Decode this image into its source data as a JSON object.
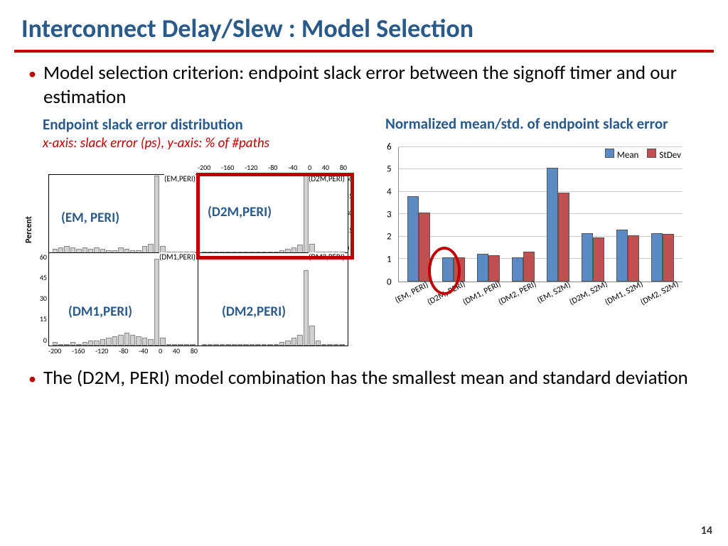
{
  "title": "Interconnect Delay/Slew : Model Selection",
  "bullets": {
    "b1": "Model selection criterion: endpoint slack error between the signoff timer and our estimation",
    "b2": "The (D2M, PERI) model combination has the smallest mean and standard deviation"
  },
  "left": {
    "subtitle": "Endpoint slack error distribution",
    "axis_note": "x-axis: slack error (ps), y-axis: % of #paths",
    "y_label": "Percent",
    "panels": {
      "tl_tiny": "(EM,PERI)",
      "tl": "(EM, PERI)",
      "tr_tiny": "(D2M,PERI)",
      "tr": "(D2M,PERI)",
      "bl_tiny": "(DM1,PERI)",
      "bl": "(DM1,PERI)",
      "br_tiny": "(DM2,PERI)",
      "br": "(DM2,PERI)"
    },
    "x_ticks": [
      "-200",
      "-160",
      "-120",
      "-80",
      "-40",
      "0",
      "40",
      "80"
    ],
    "y_ticks_left": [
      "0",
      "15",
      "30",
      "45",
      "60"
    ],
    "y_ticks_right": [
      "0",
      "15",
      "30",
      "45",
      "60"
    ]
  },
  "right": {
    "subtitle": "Normalized mean/std. of endpoint slack error",
    "legend": {
      "mean": "Mean",
      "stdev": "StDev"
    },
    "y_ticks": [
      "0",
      "1",
      "2",
      "3",
      "4",
      "5",
      "6"
    ]
  },
  "chart_data": {
    "type": "bar",
    "title": "Normalized mean/std. of endpoint slack error",
    "xlabel": "",
    "ylabel": "",
    "ylim": [
      0,
      6
    ],
    "categories": [
      "(EM, PERI)",
      "(D2M, PERI)",
      "(DM1, PERI)",
      "(DM2, PERI)",
      "(EM, S2M)",
      "(D2M, S2M)",
      "(DM1, S2M)",
      "(DM2, S2M)"
    ],
    "series": [
      {
        "name": "Mean",
        "values": [
          3.75,
          1.0,
          1.15,
          1.0,
          5.0,
          2.1,
          2.25,
          2.1
        ]
      },
      {
        "name": "StDev",
        "values": [
          3.0,
          1.0,
          1.1,
          1.25,
          3.9,
          1.9,
          2.0,
          2.05
        ]
      }
    ]
  },
  "page_number": "14"
}
